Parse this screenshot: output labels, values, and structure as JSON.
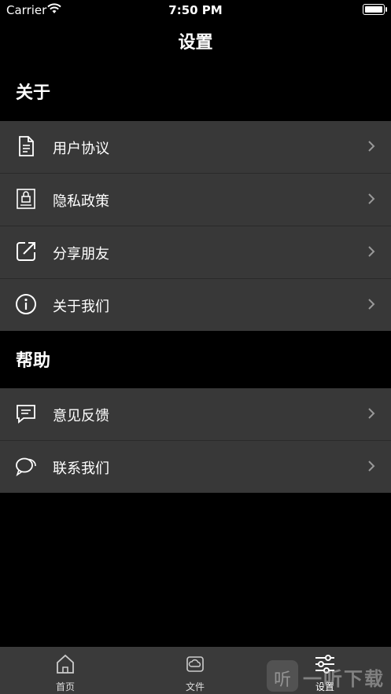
{
  "status_bar": {
    "carrier": "Carrier",
    "time": "7:50 PM"
  },
  "nav": {
    "title": "设置"
  },
  "sections": [
    {
      "header": "关于",
      "items": [
        {
          "label": "用户协议",
          "icon": "document-icon"
        },
        {
          "label": "隐私政策",
          "icon": "privacy-lock-icon"
        },
        {
          "label": "分享朋友",
          "icon": "share-icon"
        },
        {
          "label": "关于我们",
          "icon": "info-icon"
        }
      ]
    },
    {
      "header": "帮助",
      "items": [
        {
          "label": "意见反馈",
          "icon": "feedback-icon"
        },
        {
          "label": "联系我们",
          "icon": "chat-bubbles-icon"
        }
      ]
    }
  ],
  "tabs": [
    {
      "label": "首页",
      "icon": "home-icon",
      "active": false
    },
    {
      "label": "文件",
      "icon": "cloud-file-icon",
      "active": false
    },
    {
      "label": "设置",
      "icon": "settings-sliders-icon",
      "active": true
    }
  ],
  "watermark": {
    "text": "一听下载",
    "logo_text": "听"
  }
}
